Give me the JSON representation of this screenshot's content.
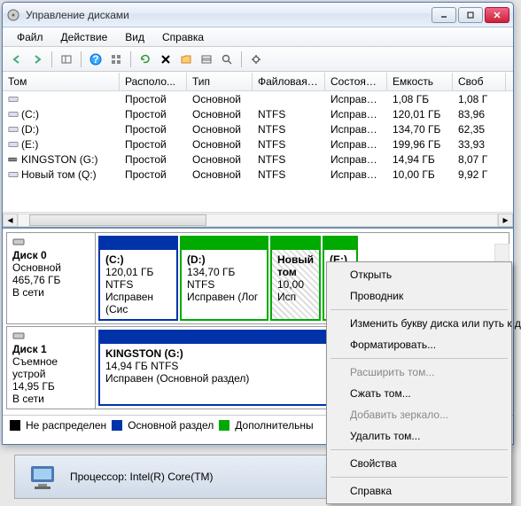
{
  "window": {
    "title": "Управление дисками"
  },
  "menu": {
    "file": "Файл",
    "action": "Действие",
    "view": "Вид",
    "help": "Справка"
  },
  "columns": {
    "tom": "Том",
    "raspolo": "Располо...",
    "tip": "Тип",
    "fs": "Файловая с...",
    "sost": "Состояние",
    "emk": "Емкость",
    "svob": "Своб"
  },
  "volumes": [
    {
      "tom": "",
      "ras": "Простой",
      "tip": "Основной",
      "fs": "",
      "sost": "Исправен...",
      "emk": "1,08 ГБ",
      "svo": "1,08 Г"
    },
    {
      "tom": "(C:)",
      "ras": "Простой",
      "tip": "Основной",
      "fs": "NTFS",
      "sost": "Исправен...",
      "emk": "120,01 ГБ",
      "svo": "83,96"
    },
    {
      "tom": "(D:)",
      "ras": "Простой",
      "tip": "Основной",
      "fs": "NTFS",
      "sost": "Исправен...",
      "emk": "134,70 ГБ",
      "svo": "62,35"
    },
    {
      "tom": "(E:)",
      "ras": "Простой",
      "tip": "Основной",
      "fs": "NTFS",
      "sost": "Исправен...",
      "emk": "199,96 ГБ",
      "svo": "33,93"
    },
    {
      "tom": "KINGSTON (G:)",
      "ras": "Простой",
      "tip": "Основной",
      "fs": "NTFS",
      "sost": "Исправен...",
      "emk": "14,94 ГБ",
      "svo": "8,07 Г"
    },
    {
      "tom": "Новый том (Q:)",
      "ras": "Простой",
      "tip": "Основной",
      "fs": "NTFS",
      "sost": "Исправен...",
      "emk": "10,00 ГБ",
      "svo": "9,92 Г"
    }
  ],
  "disk0": {
    "name": "Диск 0",
    "type": "Основной",
    "size": "465,76 ГБ",
    "status": "В сети",
    "parts": [
      {
        "label": "(C:)",
        "size": "120,01 ГБ NTFS",
        "status": "Исправен (Сис"
      },
      {
        "label": "(D:)",
        "size": "134,70 ГБ NTFS",
        "status": "Исправен (Лог"
      },
      {
        "label": "Новый том",
        "size": "10,00",
        "status": "Исп"
      },
      {
        "label": "(E:)",
        "size": "",
        "status": ""
      }
    ]
  },
  "disk1": {
    "name": "Диск 1",
    "type": "Съемное устрой",
    "size": "14,95 ГБ",
    "status": "В сети",
    "part": {
      "label": "KINGSTON  (G:)",
      "size": "14,94 ГБ NTFS",
      "status": "Исправен (Основной раздел)"
    }
  },
  "legend": {
    "unalloc": "Не распределен",
    "primary": "Основной раздел",
    "ext": "Дополнительны"
  },
  "context": {
    "open": "Открыть",
    "explorer": "Проводник",
    "changeletter": "Изменить букву диска или путь к дис",
    "format": "Форматировать...",
    "extend": "Расширить том...",
    "shrink": "Сжать том...",
    "mirror": "Добавить зеркало...",
    "delete": "Удалить том...",
    "props": "Свойства",
    "help": "Справка"
  },
  "statusbar": {
    "cpu": "Процессор: Intel(R) Core(TM)"
  }
}
